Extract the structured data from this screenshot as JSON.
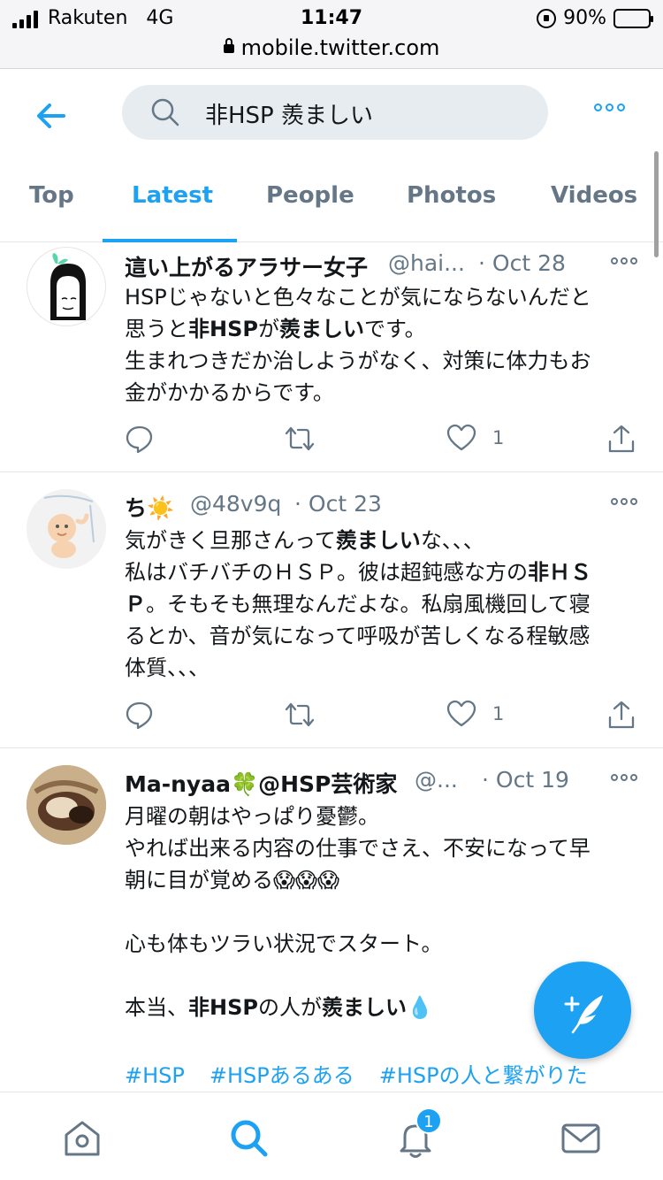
{
  "status_bar": {
    "carrier": "Rakuten",
    "network": "4G",
    "time": "11:47",
    "battery": "90%",
    "url": "mobile.twitter.com"
  },
  "header": {
    "search_query": "非HSP 羨ましい",
    "tabs": [
      "Top",
      "Latest",
      "People",
      "Photos",
      "Videos"
    ],
    "active_tab": "Latest"
  },
  "tweets": [
    {
      "name": "這い上がるアラサー女子",
      "handle": "@hai...",
      "date": "· Oct 28",
      "lines": [
        [
          {
            "t": "HSPじゃないと色々なことが気にならないんだと"
          }
        ],
        [
          {
            "t": "思うと"
          },
          {
            "t": "非HSP",
            "b": true
          },
          {
            "t": "が"
          },
          {
            "t": "羨ましい",
            "b": true
          },
          {
            "t": "です。"
          }
        ],
        [
          {
            "t": "生まれつきだか治しようがなく、対策に体力もお"
          }
        ],
        [
          {
            "t": "金がかかるからです。"
          }
        ]
      ],
      "likes": "1"
    },
    {
      "name": "ち☀️",
      "handle": "@48v9q",
      "date": "· Oct 23",
      "lines": [
        [
          {
            "t": "気がきく旦那さんって"
          },
          {
            "t": "羨ましい",
            "b": true
          },
          {
            "t": "な、、、"
          }
        ],
        [
          {
            "t": "私はバチバチのＨＳＰ。彼は超鈍感な方の"
          },
          {
            "t": "非ＨＳ",
            "b": true
          }
        ],
        [
          {
            "t": "Ｐ",
            "b": true
          },
          {
            "t": "。そもそも無理なんだよな。私扇風機回して寝"
          }
        ],
        [
          {
            "t": "るとか、音が気になって呼吸が苦しくなる程敏感"
          }
        ],
        [
          {
            "t": "体質、、、"
          }
        ]
      ],
      "likes": "1"
    },
    {
      "name": "Ma-nyaa🍀@HSP芸術家",
      "handle": "@...",
      "date": "· Oct 19",
      "lines": [
        [
          {
            "t": "月曜の朝はやっぱり憂鬱。"
          }
        ],
        [
          {
            "t": "やれば出来る内容の仕事でさえ、不安になって早"
          }
        ],
        [
          {
            "t": "朝に目が覚める😱😱😱"
          }
        ],
        [
          {
            "t": ""
          }
        ],
        [
          {
            "t": "心も体もツラい状況でスタート。"
          }
        ],
        [
          {
            "t": ""
          }
        ],
        [
          {
            "t": "本当、"
          },
          {
            "t": "非HSP",
            "b": true
          },
          {
            "t": "の人が"
          },
          {
            "t": "羨ましい",
            "b": true
          },
          {
            "t": "💧"
          }
        ]
      ],
      "hashtags": [
        "#HSP",
        "#HSPあるある",
        "#HSPの人と繋がりた"
      ]
    }
  ],
  "bottom_nav": {
    "notification_count": "1"
  },
  "colors": {
    "accent": "#1da1f2",
    "muted": "#657786",
    "text": "#14171a",
    "divider": "#e1e8ed"
  }
}
